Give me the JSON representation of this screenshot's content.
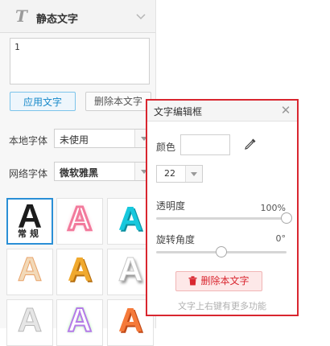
{
  "panel": {
    "title": "静态文字",
    "text_value": "1",
    "apply_label": "应用文字",
    "delete_label": "删除本文字",
    "local_font_label": "本地字体",
    "local_font_value": "未使用",
    "web_font_label": "网络字体",
    "web_font_value": "微软雅黑",
    "styles": [
      {
        "glyph": "A",
        "sub": "常规",
        "selected": true
      },
      {
        "glyph": "A"
      },
      {
        "glyph": "A"
      },
      {
        "glyph": "A"
      },
      {
        "glyph": "A"
      },
      {
        "glyph": "A"
      },
      {
        "glyph": "A"
      },
      {
        "glyph": "A"
      },
      {
        "glyph": "A"
      }
    ]
  },
  "dialog": {
    "title": "文字编辑框",
    "color_label": "颜色",
    "size_value": "22",
    "opacity_label": "透明度",
    "opacity_value": "100%",
    "opacity_level": 1.0,
    "rotation_label": "旋转角度",
    "rotation_value": "0°",
    "rotation_level": 0.5,
    "delete_label": "删除本文字",
    "hint": "文字上右键有更多功能"
  },
  "colors": {
    "accent_blue": "#1588c9",
    "dialog_border": "#d9262f"
  }
}
